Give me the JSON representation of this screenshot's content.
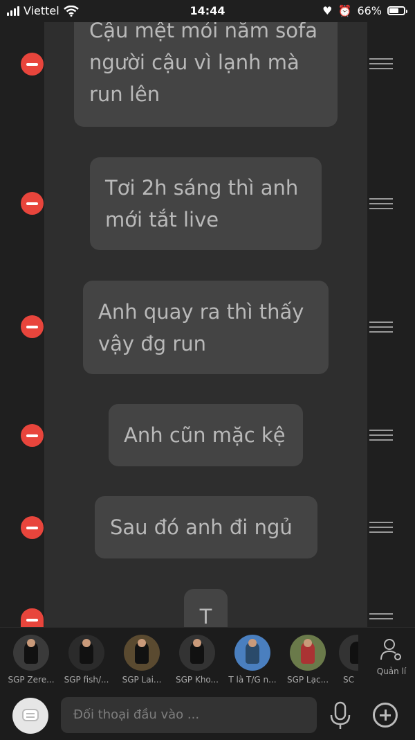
{
  "status": {
    "carrier": "Viettel",
    "time": "14:44",
    "battery": "66%"
  },
  "messages": [
    {
      "text": "Cậu mệt mỏi nằm sofa người cậu vì lạnh mà run lên"
    },
    {
      "text": "Tơi 2h sáng thì anh mới tắt live"
    },
    {
      "text": "Anh quay ra thì thấy vậy đg run"
    },
    {
      "text": "Anh cũn mặc kệ"
    },
    {
      "text": "Sau đó anh đi ngủ"
    },
    {
      "text": "T"
    }
  ],
  "contacts": [
    {
      "name": "SGP Zere..."
    },
    {
      "name": "SGP fish/..."
    },
    {
      "name": "SGP Lai..."
    },
    {
      "name": "SGP Kho..."
    },
    {
      "name": "T là T/G n..."
    },
    {
      "name": "SGP Lạc..."
    },
    {
      "name": "SC"
    }
  ],
  "manage_label": "Quản lí",
  "input": {
    "placeholder": "Đối thoại đầu vào ..."
  }
}
